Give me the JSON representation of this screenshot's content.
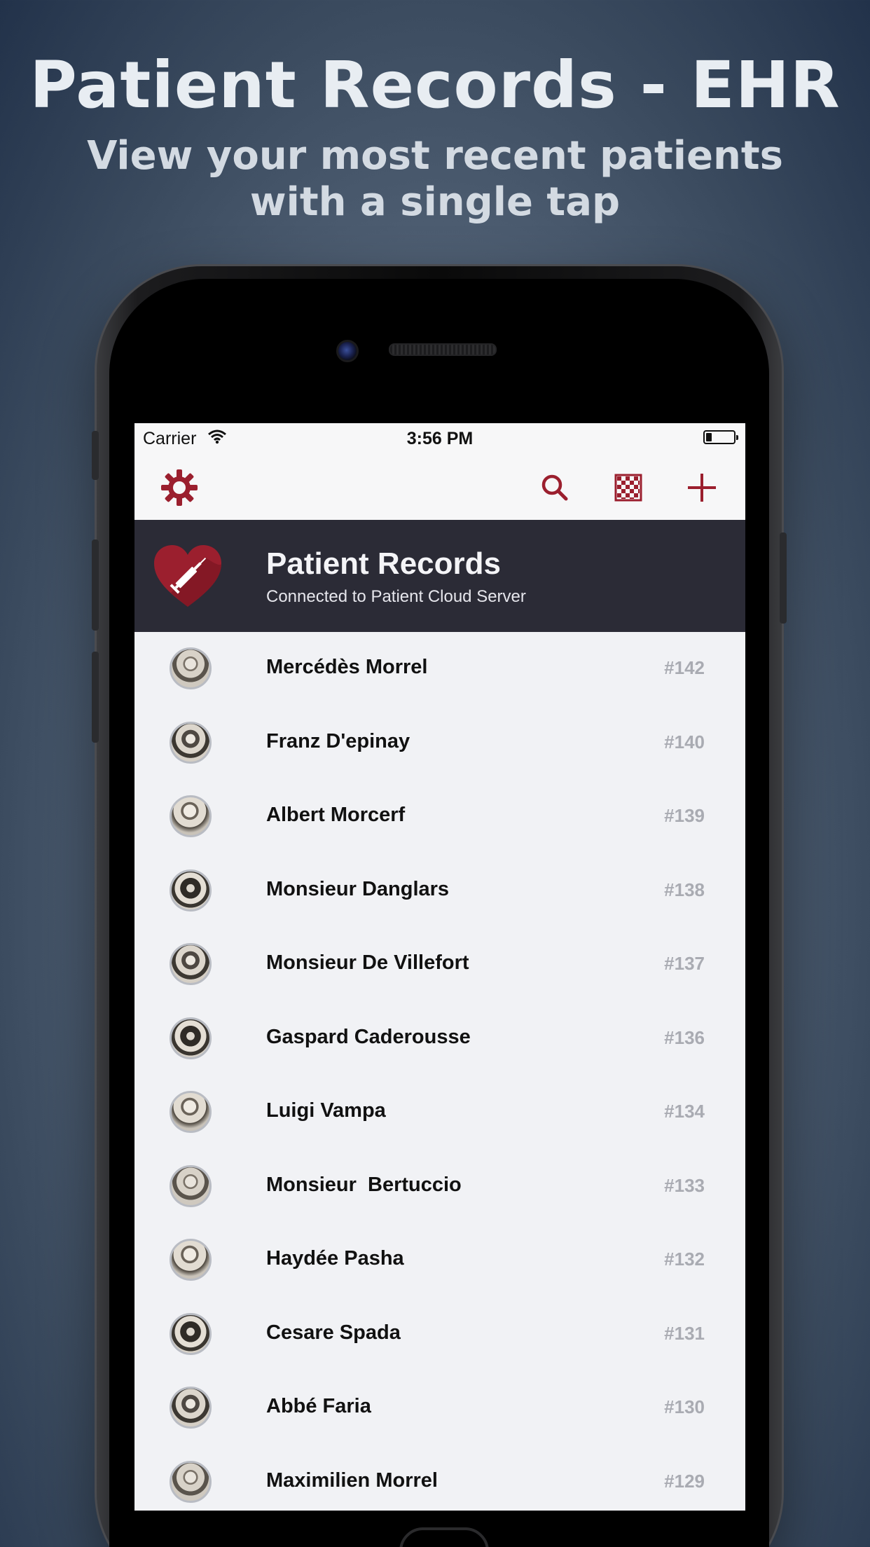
{
  "promo": {
    "title": "Patient Records - EHR",
    "subtitle_line1": "View your most recent patients",
    "subtitle_line2": "with a single tap"
  },
  "status_bar": {
    "carrier": "Carrier",
    "time": "3:56 PM",
    "wifi_icon": "wifi-icon",
    "battery_icon": "battery-icon",
    "battery_level": 0.2
  },
  "toolbar": {
    "icons": [
      "gear-icon",
      "search-icon",
      "checkerboard-icon",
      "plus-icon"
    ],
    "accent": "#9b1f2e"
  },
  "header": {
    "title": "Patient Records",
    "subtitle": "Connected to Patient Cloud Server",
    "logo_icon": "heart-syringe-icon",
    "background": "#2b2b36"
  },
  "patients": [
    {
      "name": "Mercédès Morrel",
      "id": "#142"
    },
    {
      "name": "Franz D'epinay",
      "id": "#140"
    },
    {
      "name": "Albert Morcerf",
      "id": "#139"
    },
    {
      "name": "Monsieur Danglars",
      "id": "#138"
    },
    {
      "name": "Monsieur De Villefort",
      "id": "#137"
    },
    {
      "name": "Gaspard Caderousse",
      "id": "#136"
    },
    {
      "name": "Luigi Vampa",
      "id": "#134"
    },
    {
      "name": "Monsieur  Bertuccio",
      "id": "#133"
    },
    {
      "name": "Haydée Pasha",
      "id": "#132"
    },
    {
      "name": "Cesare Spada",
      "id": "#131"
    },
    {
      "name": "Abbé Faria",
      "id": "#130"
    },
    {
      "name": "Maximilien Morrel",
      "id": "#129"
    }
  ]
}
